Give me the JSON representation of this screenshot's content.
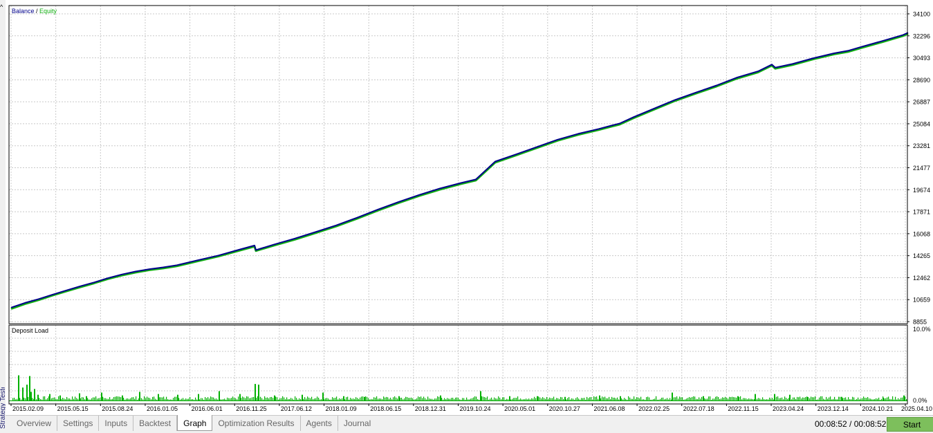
{
  "sidebar": {
    "label": "Strategy Tester",
    "caret": "^"
  },
  "legend": {
    "balance": "Balance",
    "separator": " / ",
    "equity": "Equity"
  },
  "colors": {
    "balance": "#00008b",
    "equity": "#12b012",
    "deposit": "#00b000",
    "grid": "#c8c8c8",
    "start_button": "#7dbf5c"
  },
  "chart_data": [
    {
      "type": "line",
      "ylim": [
        8855,
        34100
      ],
      "y_ticks": [
        "34100",
        "32296",
        "30493",
        "28690",
        "26887",
        "25084",
        "23281",
        "21477",
        "19674",
        "17871",
        "16068",
        "14265",
        "12462",
        "10659",
        "8855"
      ],
      "legend_entries": [
        "Balance",
        "Equity"
      ],
      "grid": true,
      "series": [
        {
          "name": "Balance",
          "points": [
            [
              0,
              10000
            ],
            [
              20,
              10380
            ],
            [
              40,
              10700
            ],
            [
              60,
              11060
            ],
            [
              80,
              11400
            ],
            [
              100,
              11740
            ],
            [
              120,
              12050
            ],
            [
              140,
              12400
            ],
            [
              160,
              12700
            ],
            [
              180,
              12940
            ],
            [
              200,
              13130
            ],
            [
              220,
              13280
            ],
            [
              240,
              13460
            ],
            [
              270,
              13860
            ],
            [
              300,
              14250
            ],
            [
              330,
              14720
            ],
            [
              352,
              15060
            ],
            [
              354,
              14690
            ],
            [
              380,
              15130
            ],
            [
              410,
              15620
            ],
            [
              440,
              16150
            ],
            [
              470,
              16700
            ],
            [
              500,
              17320
            ],
            [
              530,
              17980
            ],
            [
              560,
              18600
            ],
            [
              590,
              19180
            ],
            [
              620,
              19700
            ],
            [
              650,
              20150
            ],
            [
              672,
              20440
            ],
            [
              680,
              20860
            ],
            [
              700,
              21900
            ],
            [
              730,
              22480
            ],
            [
              760,
              23080
            ],
            [
              790,
              23680
            ],
            [
              820,
              24160
            ],
            [
              850,
              24560
            ],
            [
              870,
              24860
            ],
            [
              880,
              25000
            ],
            [
              900,
              25520
            ],
            [
              930,
              26220
            ],
            [
              960,
              26920
            ],
            [
              990,
              27520
            ],
            [
              1020,
              28100
            ],
            [
              1050,
              28750
            ],
            [
              1080,
              29250
            ],
            [
              1100,
              29800
            ],
            [
              1105,
              29550
            ],
            [
              1130,
              29850
            ],
            [
              1160,
              30320
            ],
            [
              1190,
              30720
            ],
            [
              1210,
              30920
            ],
            [
              1230,
              31250
            ],
            [
              1260,
              31720
            ],
            [
              1290,
              32220
            ],
            [
              1297,
              32400
            ]
          ]
        },
        {
          "name": "Equity",
          "points": [
            [
              0,
              9900
            ],
            [
              20,
              10300
            ],
            [
              40,
              10620
            ],
            [
              60,
              10990
            ],
            [
              80,
              11330
            ],
            [
              100,
              11660
            ],
            [
              120,
              11980
            ],
            [
              140,
              12330
            ],
            [
              160,
              12620
            ],
            [
              180,
              12860
            ],
            [
              200,
              13060
            ],
            [
              220,
              13200
            ],
            [
              240,
              13380
            ],
            [
              270,
              13780
            ],
            [
              300,
              14180
            ],
            [
              330,
              14640
            ],
            [
              352,
              14980
            ],
            [
              354,
              14620
            ],
            [
              380,
              15060
            ],
            [
              410,
              15540
            ],
            [
              440,
              16070
            ],
            [
              470,
              16620
            ],
            [
              500,
              17240
            ],
            [
              530,
              17900
            ],
            [
              560,
              18520
            ],
            [
              590,
              19100
            ],
            [
              620,
              19620
            ],
            [
              650,
              20070
            ],
            [
              672,
              20360
            ],
            [
              680,
              20780
            ],
            [
              700,
              21820
            ],
            [
              730,
              22400
            ],
            [
              760,
              23000
            ],
            [
              790,
              23600
            ],
            [
              820,
              24080
            ],
            [
              850,
              24480
            ],
            [
              870,
              24780
            ],
            [
              880,
              24920
            ],
            [
              900,
              25440
            ],
            [
              930,
              26140
            ],
            [
              960,
              26840
            ],
            [
              990,
              27440
            ],
            [
              1020,
              28020
            ],
            [
              1050,
              28670
            ],
            [
              1080,
              29170
            ],
            [
              1100,
              29720
            ],
            [
              1105,
              29470
            ],
            [
              1130,
              29770
            ],
            [
              1160,
              30240
            ],
            [
              1190,
              30640
            ],
            [
              1210,
              30840
            ],
            [
              1230,
              31170
            ],
            [
              1260,
              31640
            ],
            [
              1290,
              32140
            ],
            [
              1297,
              32320
            ]
          ]
        }
      ]
    },
    {
      "type": "bar",
      "title": "Deposit Load",
      "ylim": [
        0,
        10
      ],
      "y_ticks": [
        "10.0%",
        "0.0%"
      ],
      "x_ticks": [
        "2015.02.09",
        "2015.05.15",
        "2015.08.24",
        "2016.01.05",
        "2016.06.01",
        "2016.11.25",
        "2017.06.12",
        "2018.01.09",
        "2018.06.15",
        "2018.12.31",
        "2019.10.24",
        "2020.05.01",
        "2020.10.27",
        "2021.06.08",
        "2022.02.25",
        "2022.07.18",
        "2022.11.15",
        "2023.04.24",
        "2023.12.14",
        "2024.10.21",
        "2025.04.10"
      ],
      "spikes": [
        [
          10,
          3.5
        ],
        [
          16,
          1.8
        ],
        [
          22,
          2.2
        ],
        [
          26,
          3.4
        ],
        [
          28,
          1.2
        ],
        [
          33,
          1.6
        ],
        [
          38,
          0.8
        ],
        [
          55,
          0.9
        ],
        [
          70,
          0.7
        ],
        [
          98,
          1.0
        ],
        [
          108,
          0.6
        ],
        [
          130,
          1.1
        ],
        [
          160,
          0.7
        ],
        [
          185,
          1.2
        ],
        [
          212,
          0.9
        ],
        [
          240,
          0.8
        ],
        [
          270,
          0.9
        ],
        [
          300,
          1.3
        ],
        [
          330,
          0.9
        ],
        [
          352,
          2.3
        ],
        [
          357,
          2.2
        ],
        [
          380,
          0.7
        ],
        [
          420,
          0.8
        ],
        [
          450,
          1.1
        ],
        [
          480,
          0.6
        ],
        [
          510,
          0.5
        ],
        [
          560,
          0.6
        ],
        [
          620,
          0.7
        ],
        [
          678,
          1.3
        ],
        [
          720,
          0.6
        ],
        [
          760,
          0.6
        ],
        [
          800,
          0.5
        ],
        [
          850,
          0.7
        ],
        [
          880,
          0.6
        ],
        [
          955,
          1.1
        ],
        [
          1000,
          0.6
        ],
        [
          1050,
          0.6
        ],
        [
          1075,
          0.9
        ],
        [
          1103,
          0.9
        ],
        [
          1125,
          0.8
        ],
        [
          1150,
          0.5
        ],
        [
          1200,
          0.5
        ],
        [
          1260,
          0.4
        ],
        [
          1290,
          0.7
        ]
      ],
      "baseline": 0.35
    }
  ],
  "tabs": [
    {
      "label": "Overview",
      "active": false
    },
    {
      "label": "Settings",
      "active": false
    },
    {
      "label": "Inputs",
      "active": false
    },
    {
      "label": "Backtest",
      "active": false
    },
    {
      "label": "Graph",
      "active": true
    },
    {
      "label": "Optimization Results",
      "active": false
    },
    {
      "label": "Agents",
      "active": false
    },
    {
      "label": "Journal",
      "active": false
    }
  ],
  "timer": "00:08:52 / 00:08:52",
  "start_button": {
    "label": "Start"
  }
}
